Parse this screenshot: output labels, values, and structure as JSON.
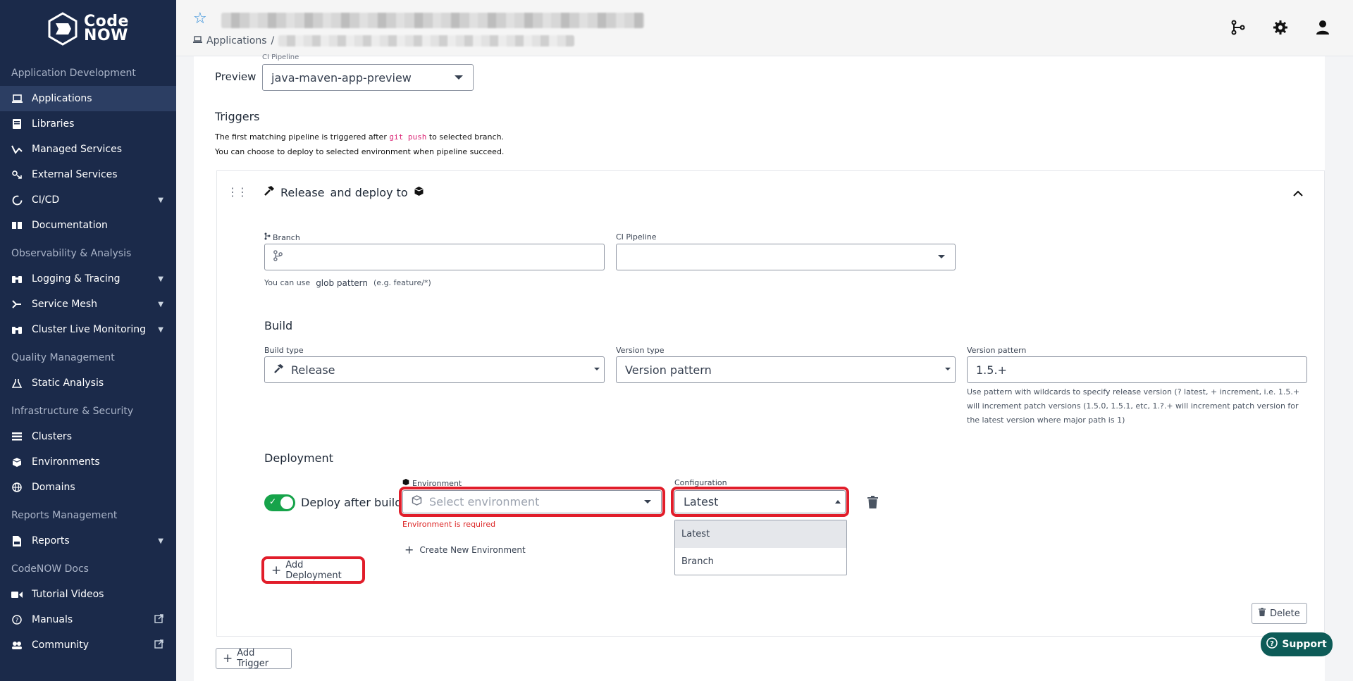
{
  "logo": {
    "line1": "Code",
    "line2": "NOW"
  },
  "sidebar": {
    "sections": [
      {
        "title": "Application Development",
        "items": [
          {
            "label": "Applications",
            "icon": "laptop-icon",
            "active": true
          },
          {
            "label": "Libraries",
            "icon": "book-icon"
          },
          {
            "label": "Managed Services",
            "icon": "managed-services-icon"
          },
          {
            "label": "External Services",
            "icon": "external-services-icon"
          },
          {
            "label": "CI/CD",
            "icon": "cicd-icon",
            "expandable": true
          },
          {
            "label": "Documentation",
            "icon": "documentation-icon"
          }
        ]
      },
      {
        "title": "Observability & Analysis",
        "items": [
          {
            "label": "Logging & Tracing",
            "icon": "binoculars-icon",
            "expandable": true
          },
          {
            "label": "Service Mesh",
            "icon": "service-mesh-icon",
            "expandable": true
          },
          {
            "label": "Cluster Live Monitoring",
            "icon": "binoculars-icon",
            "expandable": true
          }
        ]
      },
      {
        "title": "Quality Management",
        "items": [
          {
            "label": "Static Analysis",
            "icon": "flask-icon"
          }
        ]
      },
      {
        "title": "Infrastructure & Security",
        "items": [
          {
            "label": "Clusters",
            "icon": "list-icon"
          },
          {
            "label": "Environments",
            "icon": "cube-icon"
          },
          {
            "label": "Domains",
            "icon": "globe-icon"
          }
        ]
      },
      {
        "title": "Reports Management",
        "items": [
          {
            "label": "Reports",
            "icon": "csv-file-icon",
            "expandable": true
          }
        ]
      },
      {
        "title": "CodeNOW Docs",
        "items": [
          {
            "label": "Tutorial Videos",
            "icon": "video-icon"
          },
          {
            "label": "Manuals",
            "icon": "question-icon",
            "external": true
          },
          {
            "label": "Community",
            "icon": "community-icon",
            "external": true
          }
        ]
      }
    ]
  },
  "header": {
    "breadcrumb_root": "Applications",
    "breadcrumb_sep": "/"
  },
  "preview": {
    "label": "Preview",
    "pipeline_label": "CI Pipeline",
    "pipeline_value": "java-maven-app-preview"
  },
  "triggers": {
    "title": "Triggers",
    "desc1_before": "The first matching pipeline is triggered after",
    "desc1_code": "git push",
    "desc1_after": "to selected branch.",
    "desc2": "You can choose to deploy to selected environment when pipeline succeed."
  },
  "trigger": {
    "heading_type": "Release",
    "heading_and": "and deploy to",
    "branch_label": "Branch",
    "branch_value": "",
    "ci_pipeline_label": "CI Pipeline",
    "ci_pipeline_value": "",
    "hint_prefix": "You can use",
    "hint_link": "glob pattern",
    "hint_example": "(e.g. feature/*)",
    "build_title": "Build",
    "build_type_label": "Build type",
    "build_type_value": "Release",
    "version_type_label": "Version type",
    "version_type_value": "Version pattern",
    "version_pattern_label": "Version pattern",
    "version_pattern_value": "1.5.+",
    "version_help": "Use pattern with wildcards to specify release version (? latest, + increment, i.e. 1.5.+ will increment patch versions (1.5.0, 1.5.1, etc, 1.?.+ will increment patch version for the latest version where major path is 1)",
    "deployment_title": "Deployment",
    "deploy_after_build_label": "Deploy after build",
    "deploy_after_build": true,
    "environment_label": "Environment",
    "environment_placeholder": "Select environment",
    "environment_error": "Environment is required",
    "create_env_label": "Create New Environment",
    "configuration_label": "Configuration",
    "configuration_value": "Latest",
    "configuration_options": [
      "Latest",
      "Branch"
    ],
    "add_deployment_label": "Add Deployment",
    "delete_label": "Delete"
  },
  "add_trigger_label": "Add Trigger",
  "support_label": "Support",
  "colors": {
    "sidebar": "#1b2a4a",
    "accent_red": "#e11d2a",
    "toggle_green": "#16a34a",
    "support": "#0d5b57"
  }
}
